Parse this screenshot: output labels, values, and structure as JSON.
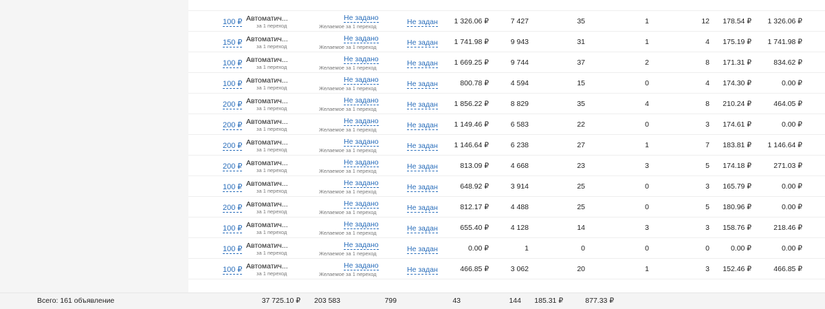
{
  "rows": [
    {
      "bid": "100 ₽",
      "name": "Автоматич...",
      "sub": "за 1 переход",
      "desired": "Не задано",
      "desired_sub": "Желаемое за 1 переход",
      "target": "Не задан",
      "spend": "1 326.06 ₽",
      "impressions": "7 427",
      "clicks": "35",
      "conversions": "1",
      "col5": "12",
      "cpc": "178.54 ₽",
      "revenue": "1 326.06 ₽"
    },
    {
      "bid": "150 ₽",
      "name": "Автоматич...",
      "sub": "за 1 переход",
      "desired": "Не задано",
      "desired_sub": "Желаемое за 1 переход",
      "target": "Не задан",
      "spend": "1 741.98 ₽",
      "impressions": "9 943",
      "clicks": "31",
      "conversions": "1",
      "col5": "4",
      "cpc": "175.19 ₽",
      "revenue": "1 741.98 ₽"
    },
    {
      "bid": "100 ₽",
      "name": "Автоматич...",
      "sub": "за 1 переход",
      "desired": "Не задано",
      "desired_sub": "Желаемое за 1 переход",
      "target": "Не задан",
      "spend": "1 669.25 ₽",
      "impressions": "9 744",
      "clicks": "37",
      "conversions": "2",
      "col5": "8",
      "cpc": "171.31 ₽",
      "revenue": "834.62 ₽"
    },
    {
      "bid": "100 ₽",
      "name": "Автоматич...",
      "sub": "за 1 переход",
      "desired": "Не задано",
      "desired_sub": "Желаемое за 1 переход",
      "target": "Не задан",
      "spend": "800.78 ₽",
      "impressions": "4 594",
      "clicks": "15",
      "conversions": "0",
      "col5": "4",
      "cpc": "174.30 ₽",
      "revenue": "0.00 ₽"
    },
    {
      "bid": "200 ₽",
      "name": "Автоматич...",
      "sub": "за 1 переход",
      "desired": "Не задано",
      "desired_sub": "Желаемое за 1 переход",
      "target": "Не задан",
      "spend": "1 856.22 ₽",
      "impressions": "8 829",
      "clicks": "35",
      "conversions": "4",
      "col5": "8",
      "cpc": "210.24 ₽",
      "revenue": "464.05 ₽"
    },
    {
      "bid": "200 ₽",
      "name": "Автоматич...",
      "sub": "за 1 переход",
      "desired": "Не задано",
      "desired_sub": "Желаемое за 1 переход",
      "target": "Не задан",
      "spend": "1 149.46 ₽",
      "impressions": "6 583",
      "clicks": "22",
      "conversions": "0",
      "col5": "3",
      "cpc": "174.61 ₽",
      "revenue": "0.00 ₽"
    },
    {
      "bid": "200 ₽",
      "name": "Автоматич...",
      "sub": "за 1 переход",
      "desired": "Не задано",
      "desired_sub": "Желаемое за 1 переход",
      "target": "Не задан",
      "spend": "1 146.64 ₽",
      "impressions": "6 238",
      "clicks": "27",
      "conversions": "1",
      "col5": "7",
      "cpc": "183.81 ₽",
      "revenue": "1 146.64 ₽"
    },
    {
      "bid": "200 ₽",
      "name": "Автоматич...",
      "sub": "за 1 переход",
      "desired": "Не задано",
      "desired_sub": "Желаемое за 1 переход",
      "target": "Не задан",
      "spend": "813.09 ₽",
      "impressions": "4 668",
      "clicks": "23",
      "conversions": "3",
      "col5": "5",
      "cpc": "174.18 ₽",
      "revenue": "271.03 ₽"
    },
    {
      "bid": "100 ₽",
      "name": "Автоматич...",
      "sub": "за 1 переход",
      "desired": "Не задано",
      "desired_sub": "Желаемое за 1 переход",
      "target": "Не задан",
      "spend": "648.92 ₽",
      "impressions": "3 914",
      "clicks": "25",
      "conversions": "0",
      "col5": "3",
      "cpc": "165.79 ₽",
      "revenue": "0.00 ₽"
    },
    {
      "bid": "200 ₽",
      "name": "Автоматич...",
      "sub": "за 1 переход",
      "desired": "Не задано",
      "desired_sub": "Желаемое за 1 переход",
      "target": "Не задан",
      "spend": "812.17 ₽",
      "impressions": "4 488",
      "clicks": "25",
      "conversions": "0",
      "col5": "5",
      "cpc": "180.96 ₽",
      "revenue": "0.00 ₽"
    },
    {
      "bid": "100 ₽",
      "name": "Автоматич...",
      "sub": "за 1 переход",
      "desired": "Не задано",
      "desired_sub": "Желаемое за 1 переход",
      "target": "Не задан",
      "spend": "655.40 ₽",
      "impressions": "4 128",
      "clicks": "14",
      "conversions": "3",
      "col5": "3",
      "cpc": "158.76 ₽",
      "revenue": "218.46 ₽"
    },
    {
      "bid": "100 ₽",
      "name": "Автоматич...",
      "sub": "за 1 переход",
      "desired": "Не задано",
      "desired_sub": "Желаемое за 1 переход",
      "target": "Не задан",
      "spend": "0.00 ₽",
      "impressions": "1",
      "clicks": "0",
      "conversions": "0",
      "col5": "0",
      "cpc": "0.00 ₽",
      "revenue": "0.00 ₽"
    },
    {
      "bid": "100 ₽",
      "name": "Автоматич...",
      "sub": "за 1 переход",
      "desired": "Не задано",
      "desired_sub": "Желаемое за 1 переход",
      "target": "Не задан",
      "spend": "466.85 ₽",
      "impressions": "3 062",
      "clicks": "20",
      "conversions": "1",
      "col5": "3",
      "cpc": "152.46 ₽",
      "revenue": "466.85 ₽"
    }
  ],
  "footer": {
    "label": "Всего: 161 объявление",
    "spend": "37 725.10 ₽",
    "impressions": "203 583",
    "clicks": "799",
    "conversions": "43",
    "col5": "144",
    "cpc": "185.31 ₽",
    "revenue": "877.33 ₽"
  }
}
